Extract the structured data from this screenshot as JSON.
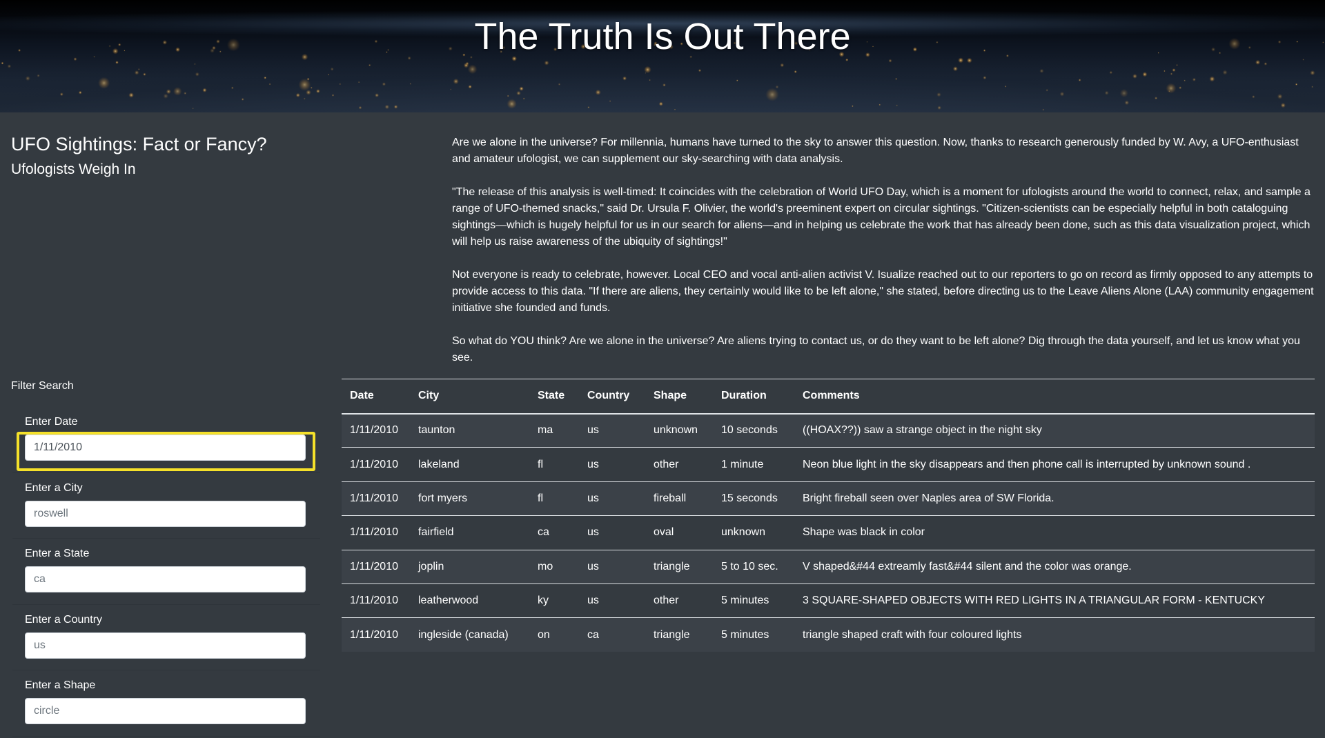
{
  "hero": {
    "title": "The Truth Is Out There"
  },
  "intro": {
    "title": "UFO Sightings: Fact or Fancy?",
    "subtitle": "Ufologists Weigh In"
  },
  "article": {
    "paragraphs": [
      "Are we alone in the universe? For millennia, humans have turned to the sky to answer this question. Now, thanks to research generously funded by W. Avy, a UFO-enthusiast and amateur ufologist, we can supplement our sky-searching with data analysis.",
      "\"The release of this analysis is well-timed: It coincides with the celebration of World UFO Day, which is a moment for ufologists around the world to connect, relax, and sample a range of UFO-themed snacks,\" said Dr. Ursula F. Olivier, the world's preeminent expert on circular sightings. \"Citizen-scientists can be especially helpful in both cataloguing sightings—which is hugely helpful for us in our search for aliens—and in helping us celebrate the work that has already been done, such as this data visualization project, which will help us raise awareness of the ubiquity of sightings!\"",
      "Not everyone is ready to celebrate, however. Local CEO and vocal anti-alien activist V. Isualize reached out to our reporters to go on record as firmly opposed to any attempts to provide access to this data. \"If there are aliens, they certainly would like to be left alone,\" she stated, before directing us to the Leave Aliens Alone (LAA) community engagement initiative she founded and funds.",
      "So what do YOU think? Are we alone in the universe? Are aliens trying to contact us, or do they want to be left alone? Dig through the data yourself, and let us know what you see."
    ]
  },
  "filters": {
    "heading": "Filter Search",
    "items": [
      {
        "label": "Enter Date",
        "value": "1/11/2010",
        "placeholder": ""
      },
      {
        "label": "Enter a City",
        "value": "",
        "placeholder": "roswell"
      },
      {
        "label": "Enter a State",
        "value": "",
        "placeholder": "ca"
      },
      {
        "label": "Enter a Country",
        "value": "",
        "placeholder": "us"
      },
      {
        "label": "Enter a Shape",
        "value": "",
        "placeholder": "circle"
      }
    ],
    "highlight_color": "#f5e12a"
  },
  "table": {
    "headers": [
      "Date",
      "City",
      "State",
      "Country",
      "Shape",
      "Duration",
      "Comments"
    ],
    "rows": [
      [
        "1/11/2010",
        "taunton",
        "ma",
        "us",
        "unknown",
        "10 seconds",
        "((HOAX??)) saw a strange object in the night sky"
      ],
      [
        "1/11/2010",
        "lakeland",
        "fl",
        "us",
        "other",
        "1 minute",
        "Neon blue light in the sky disappears and then phone call is interrupted by unknown sound ."
      ],
      [
        "1/11/2010",
        "fort myers",
        "fl",
        "us",
        "fireball",
        "15 seconds",
        "Bright fireball seen over Naples area of SW Florida."
      ],
      [
        "1/11/2010",
        "fairfield",
        "ca",
        "us",
        "oval",
        "unknown",
        "Shape was black in color"
      ],
      [
        "1/11/2010",
        "joplin",
        "mo",
        "us",
        "triangle",
        "5 to 10 sec.",
        "V shaped&#44 extreamly fast&#44 silent and the color was orange."
      ],
      [
        "1/11/2010",
        "leatherwood",
        "ky",
        "us",
        "other",
        "5 minutes",
        "3 SQUARE-SHAPED OBJECTS WITH RED LIGHTS IN A TRIANGULAR FORM - KENTUCKY"
      ],
      [
        "1/11/2010",
        "ingleside (canada)",
        "on",
        "ca",
        "triangle",
        "5 minutes",
        "triangle shaped craft with four coloured lights"
      ]
    ]
  },
  "colors": {
    "background": "#343a40",
    "text": "#ffffff"
  }
}
